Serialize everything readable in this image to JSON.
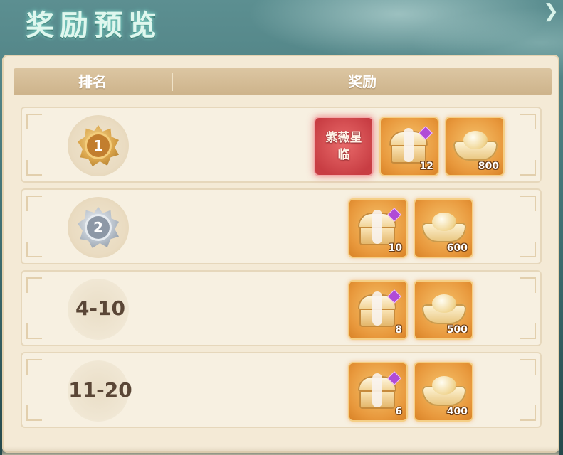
{
  "window": {
    "title": "奖励预览"
  },
  "table": {
    "headers": {
      "rank": "排名",
      "reward": "奖励"
    },
    "rows": [
      {
        "rank_label": "1",
        "rank_style": "gold-medal",
        "rewards": [
          {
            "type": "title-badge",
            "label": "紫薇星临",
            "count": ""
          },
          {
            "type": "chest",
            "icon": "treasure-chest-icon",
            "count": "12"
          },
          {
            "type": "gold-ingot",
            "icon": "gold-ingot-icon",
            "count": "800"
          }
        ]
      },
      {
        "rank_label": "2",
        "rank_style": "silver-medal",
        "rewards": [
          {
            "type": "chest",
            "icon": "treasure-chest-icon",
            "count": "10"
          },
          {
            "type": "gold-ingot",
            "icon": "gold-ingot-icon",
            "count": "600"
          }
        ]
      },
      {
        "rank_label": "4-10",
        "rank_style": "text",
        "rewards": [
          {
            "type": "chest",
            "icon": "treasure-chest-icon",
            "count": "8"
          },
          {
            "type": "gold-ingot",
            "icon": "gold-ingot-icon",
            "count": "500"
          }
        ]
      },
      {
        "rank_label": "11-20",
        "rank_style": "text",
        "rewards": [
          {
            "type": "chest",
            "icon": "treasure-chest-icon",
            "count": "6"
          },
          {
            "type": "gold-ingot",
            "icon": "gold-ingot-icon",
            "count": "400"
          }
        ]
      }
    ]
  },
  "colors": {
    "panel_bg": "#f4ead6",
    "header_bg": "#d3bb94",
    "rare_item_bg": "#e8983c",
    "title_badge_bg": "#c83d43",
    "rank_text": "#5a4636"
  }
}
